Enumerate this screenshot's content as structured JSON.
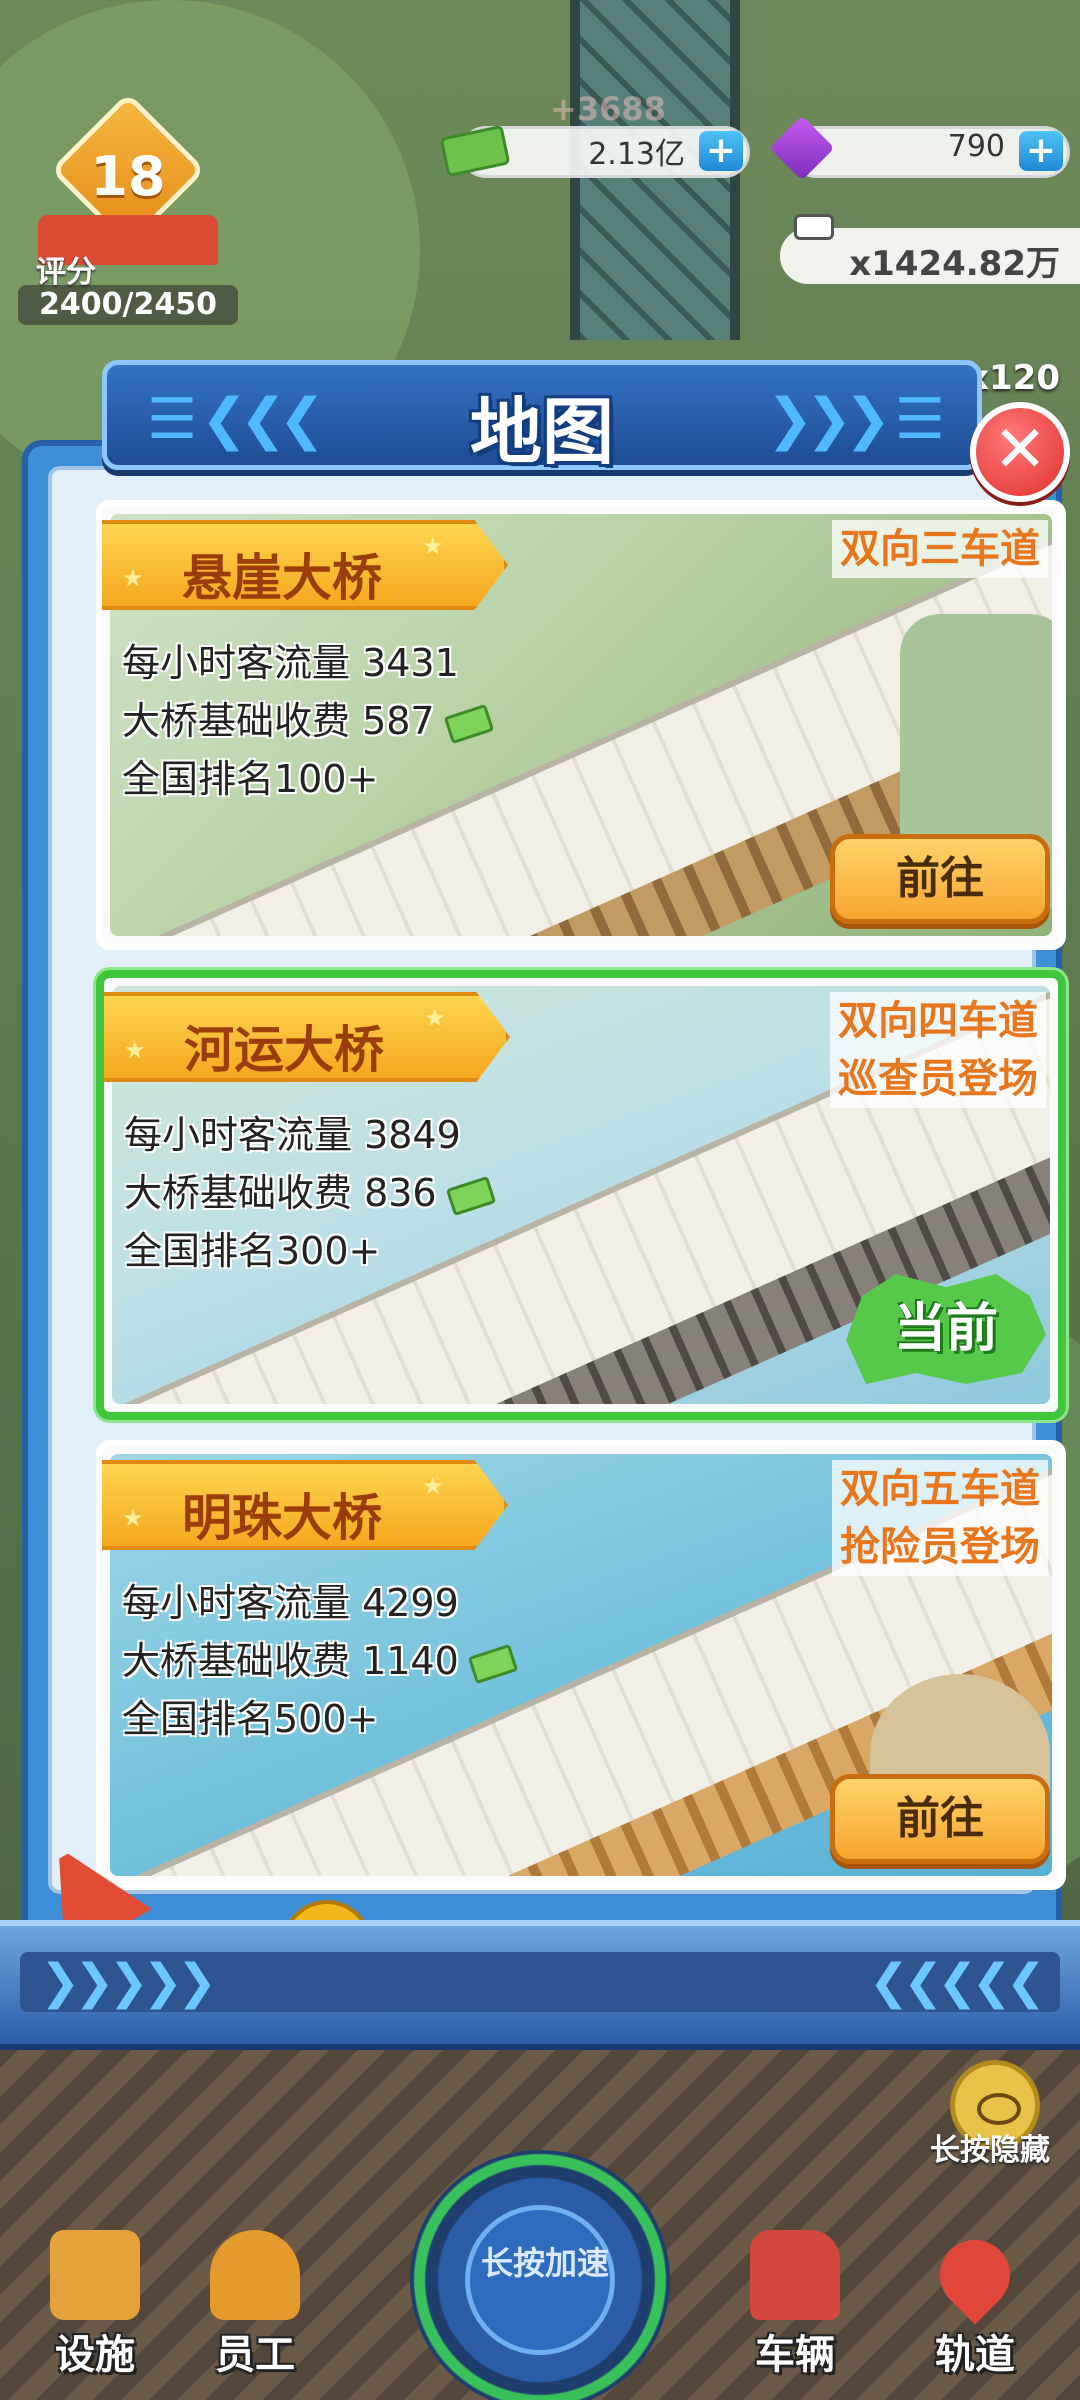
{
  "hud": {
    "level": "18",
    "rating_label": "评分",
    "rating_value": "2400/2450",
    "ghost_income": "+3688",
    "cash": "2.13亿",
    "gems": "790",
    "reward_cash": "x1424.82万",
    "reward_gems": "x120"
  },
  "dialog": {
    "title": "地图",
    "bridges": [
      {
        "name": "悬崖大桥",
        "features": [
          "双向三车道"
        ],
        "stats": [
          "每小时客流量 3431",
          "大桥基础收费 587",
          "全国排名100+"
        ],
        "action": "前往"
      },
      {
        "name": "河运大桥",
        "features": [
          "双向四车道",
          "巡查员登场"
        ],
        "stats": [
          "每小时客流量 3849",
          "大桥基础收费 836",
          "全国排名300+"
        ],
        "action": "当前"
      },
      {
        "name": "明珠大桥",
        "features": [
          "双向五车道",
          "抢险员登场"
        ],
        "stats": [
          "每小时客流量 4299",
          "大桥基础收费 1140",
          "全国排名500+"
        ],
        "action": "前往"
      }
    ]
  },
  "long_press_hide": "长按隐藏",
  "nav": {
    "facilities": "设施",
    "staff": "员工",
    "speed_up": "长按加速",
    "vehicles": "车辆",
    "tracks": "轨道"
  },
  "colors": {
    "accent_orange": "#e8761c",
    "current_green": "#3fc63c",
    "dialog_blue": "#3f8fd8"
  }
}
